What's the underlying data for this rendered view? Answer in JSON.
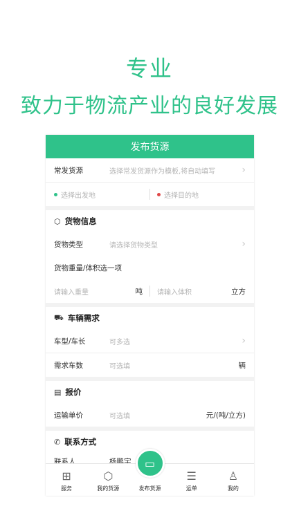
{
  "headline": {
    "line1": "专业",
    "line2": "致力于物流产业的良好发展"
  },
  "colors": {
    "accent": "#2fc28a",
    "origin_dot": "#2fc28a",
    "dest_dot": "#e04848"
  },
  "screen": {
    "title": "发布货源",
    "frequent": {
      "label": "常发货源",
      "placeholder": "选择常发货源作为模板,将自动填写"
    },
    "route": {
      "origin": "选择出发地",
      "destination": "选择目的地"
    },
    "cargo": {
      "header": "货物信息",
      "type_label": "货物类型",
      "type_placeholder": "请选择货物类型",
      "weight_title": "货物重量/体积选一项",
      "weight_placeholder": "请输入重量",
      "weight_unit": "吨",
      "volume_placeholder": "请输入体积",
      "volume_unit": "立方"
    },
    "vehicle": {
      "header": "车辆需求",
      "model_label": "车型/车长",
      "model_placeholder": "可多选",
      "count_label": "需求车数",
      "count_placeholder": "可选填",
      "count_unit": "辆"
    },
    "price": {
      "header": "报价",
      "unit_label": "运输单价",
      "unit_placeholder": "可选填",
      "unit_suffix": "元/(吨/立方)"
    },
    "contact": {
      "header": "联系方式",
      "person_label": "联系人",
      "person_value": "杨鹏宇"
    },
    "tabs": [
      {
        "label": "服务",
        "icon": "grid-icon"
      },
      {
        "label": "我的货源",
        "icon": "box-icon"
      },
      {
        "label": "发布货源",
        "icon": "publish-icon"
      },
      {
        "label": "运单",
        "icon": "waybill-icon"
      },
      {
        "label": "我的",
        "icon": "user-icon"
      }
    ]
  }
}
